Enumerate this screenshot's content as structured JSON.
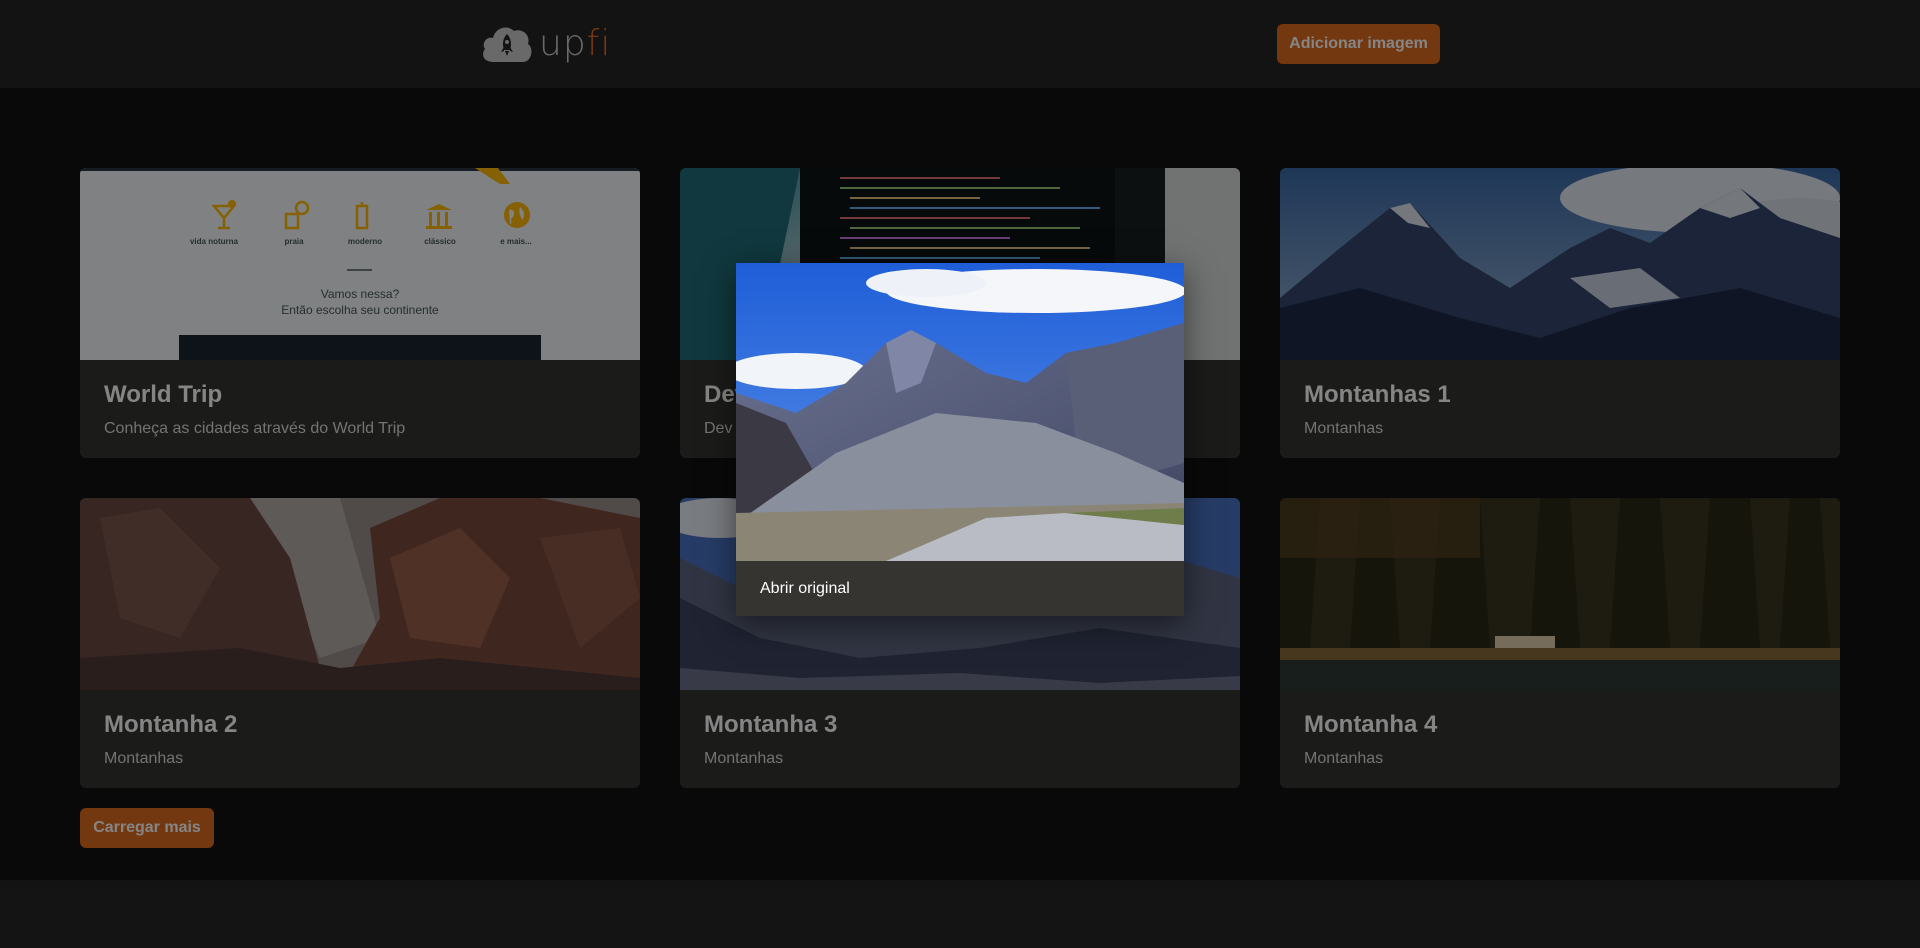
{
  "header": {
    "logo_text_up": "up",
    "logo_text_fi": "fi",
    "add_image_label": "Adicionar imagem"
  },
  "cards": [
    {
      "title": "World Trip",
      "description": "Conheça as cidades através do World Trip",
      "image": {
        "icons": [
          "vida noturna",
          "praia",
          "moderno",
          "clássico",
          "e mais..."
        ],
        "prompt_line1": "Vamos nessa?",
        "prompt_line2": "Então escolha seu continente"
      }
    },
    {
      "title": "Dev",
      "description": "Dev"
    },
    {
      "title": "Montanhas 1",
      "description": "Montanhas"
    },
    {
      "title": "Montanha 2",
      "description": "Montanhas"
    },
    {
      "title": "Montanha 3",
      "description": "Montanhas"
    },
    {
      "title": "Montanha 4",
      "description": "Montanhas"
    }
  ],
  "load_more_label": "Carregar mais",
  "modal": {
    "open_original_label": "Abrir original"
  },
  "colors": {
    "accent": "#dd6b20",
    "header_bg": "#262626",
    "page_bg": "#121212",
    "card_bg": "#353431"
  }
}
